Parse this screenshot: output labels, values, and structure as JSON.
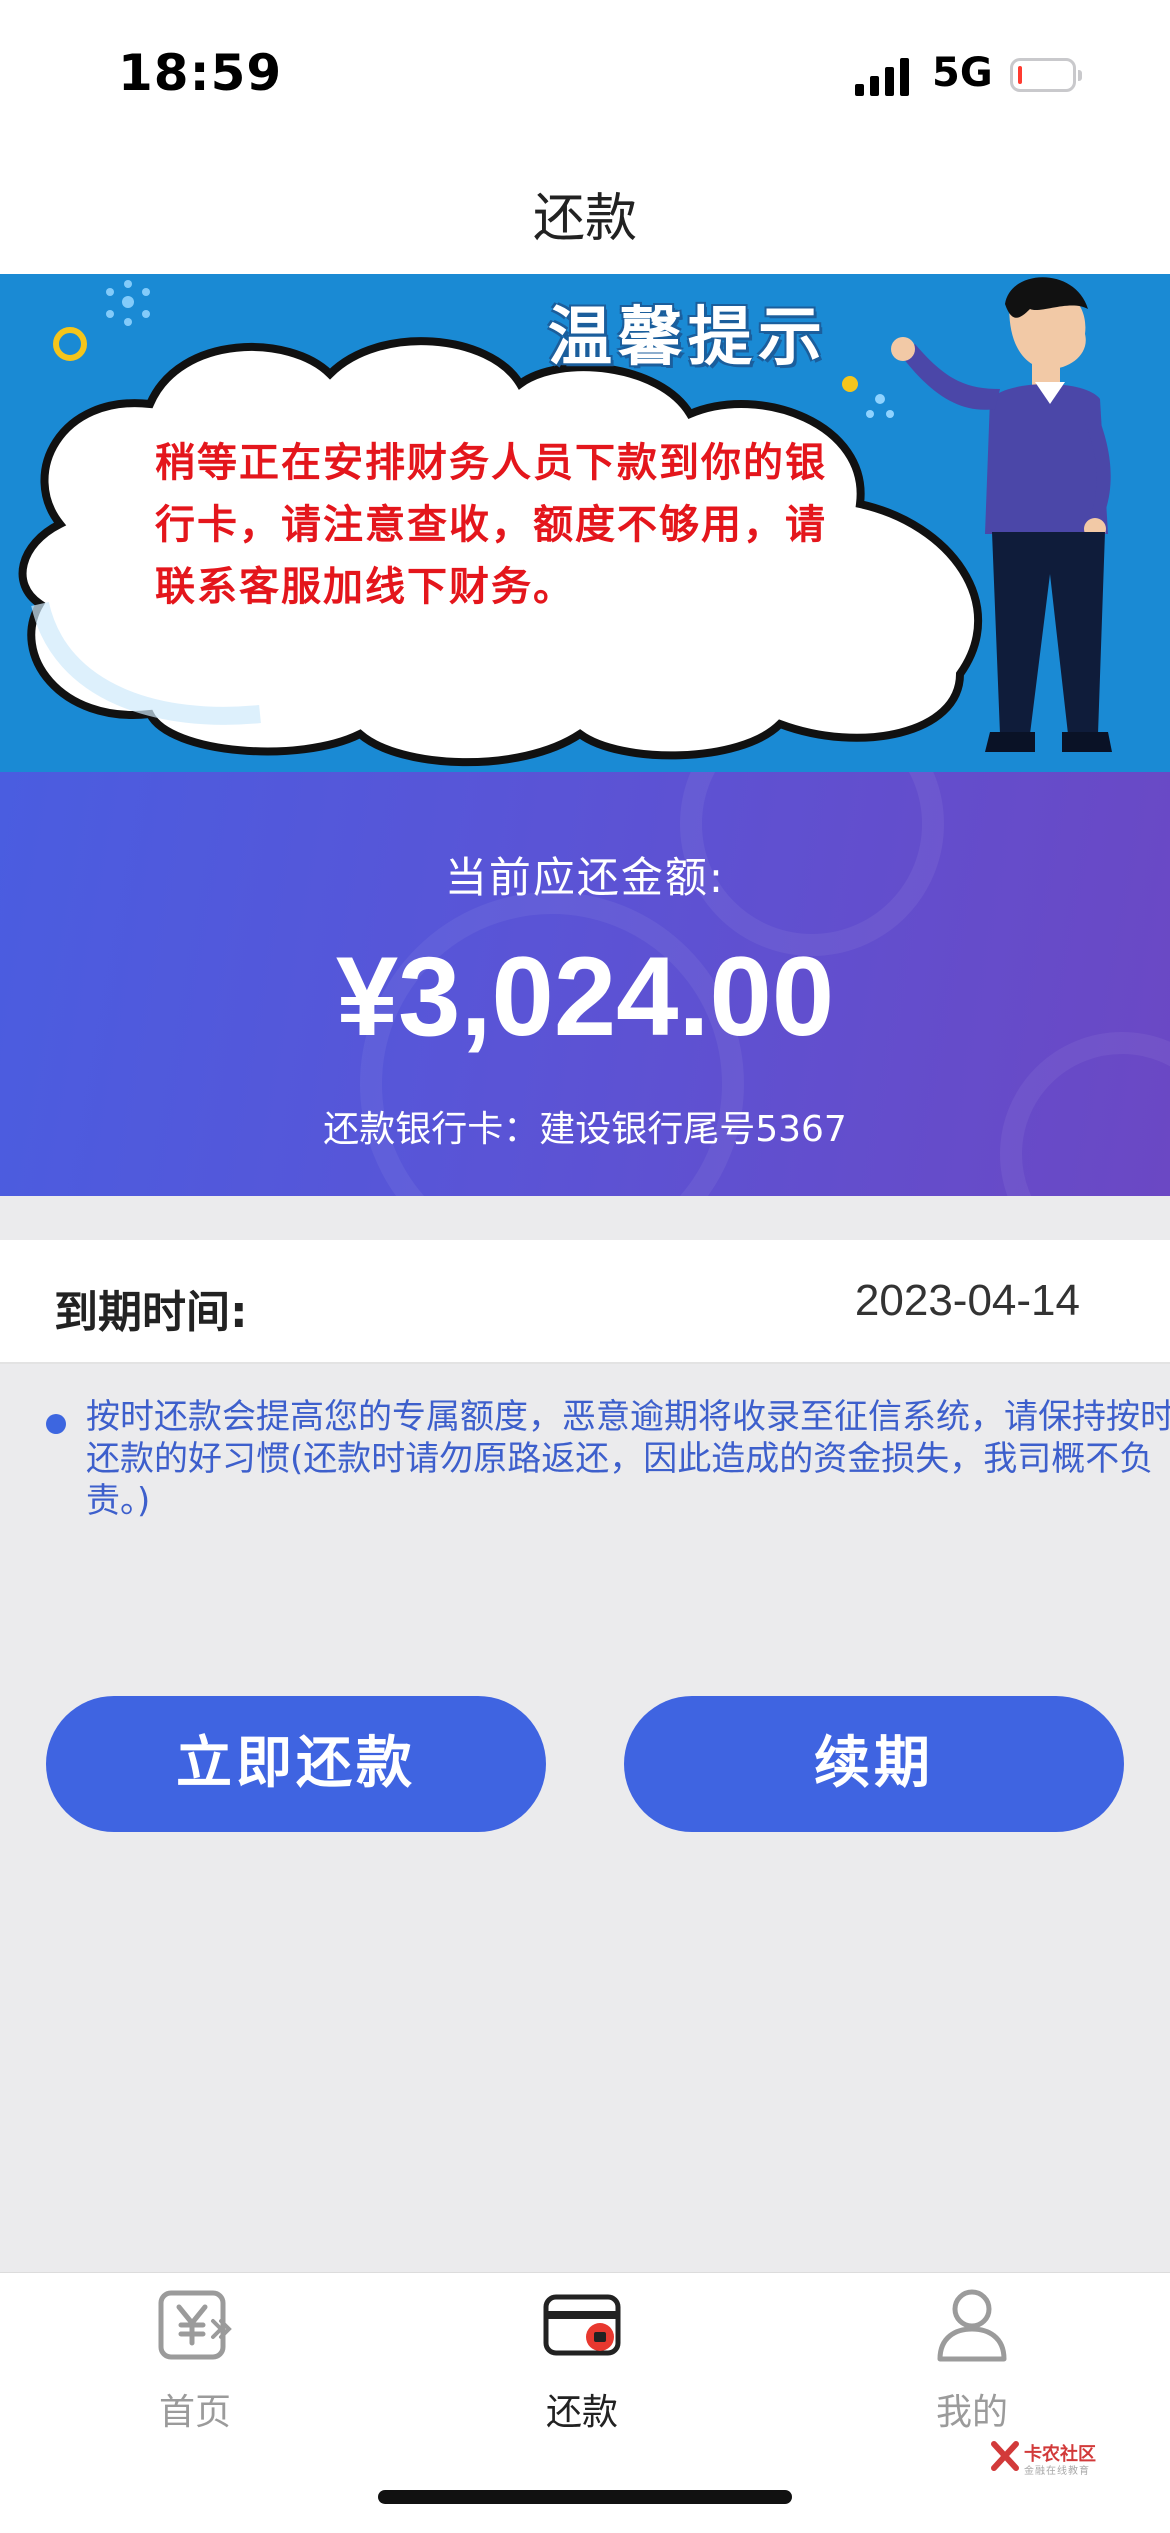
{
  "status_bar": {
    "time": "18:59",
    "network": "5G",
    "battery_level": 0.08
  },
  "header": {
    "title": "还款"
  },
  "banner": {
    "title": "温馨提示",
    "message": "稍等正在安排财务人员下款到你的银行卡，请注意查收，额度不够用，请联系客服加线下财务。"
  },
  "amount_card": {
    "label": "当前应还金额:",
    "amount": "¥3,024.00",
    "bank_info": "还款银行卡：建设银行尾号5367"
  },
  "due": {
    "label": "到期时间:",
    "date": "2023-04-14"
  },
  "notice": {
    "text": "按时还款会提高您的专属额度，恶意逾期将收录至征信系统，请保持按时还款的好习惯(还款时请勿原路返还，因此造成的资金损失，我司概不负责。)"
  },
  "buttons": {
    "repay": "立即还款",
    "renew": "续期"
  },
  "tab_bar": {
    "items": [
      {
        "label": "首页",
        "icon": "yen-card-icon",
        "active": false
      },
      {
        "label": "还款",
        "icon": "card-icon",
        "active": true
      },
      {
        "label": "我的",
        "icon": "user-icon",
        "active": false
      }
    ]
  },
  "watermark": {
    "text": "卡农社区",
    "sub": "金融在线教育"
  },
  "colors": {
    "primary": "#3f64e1",
    "banner_bg": "#1a8ad4",
    "alert_text": "#e4161c",
    "notice_text": "#3d5fcc",
    "gradient_start": "#4a5de0",
    "gradient_end": "#6b48c4"
  }
}
